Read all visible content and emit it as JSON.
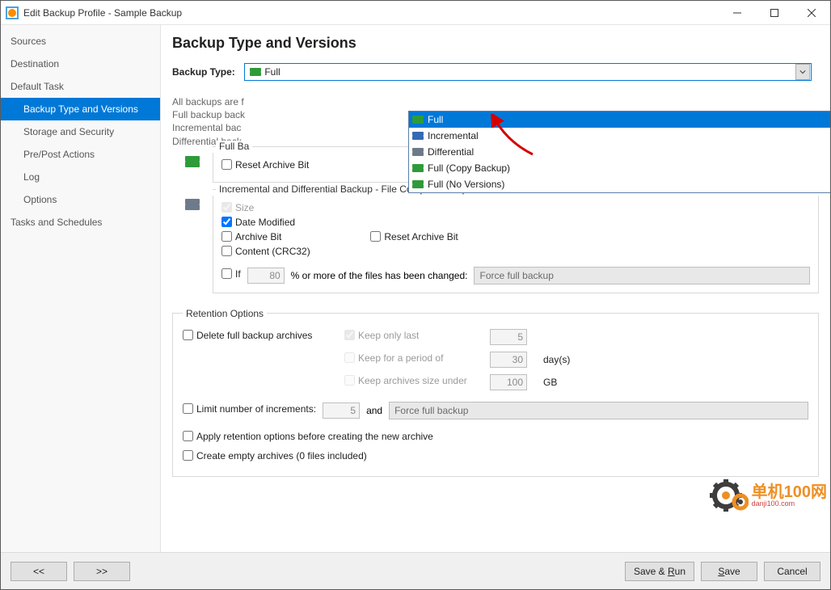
{
  "window": {
    "title": "Edit Backup Profile - Sample Backup"
  },
  "sidebar": {
    "items": [
      {
        "label": "Sources"
      },
      {
        "label": "Destination"
      },
      {
        "label": "Default Task"
      },
      {
        "label": "Backup Type and Versions"
      },
      {
        "label": "Storage and Security"
      },
      {
        "label": "Pre/Post Actions"
      },
      {
        "label": "Log"
      },
      {
        "label": "Options"
      },
      {
        "label": "Tasks and Schedules"
      }
    ]
  },
  "page": {
    "title": "Backup Type and Versions",
    "backup_type_label": "Backup Type:",
    "backup_type_value": "Full",
    "info": {
      "line1": "All backups are f",
      "line2": "Full backup back",
      "line3": "Incremental bac",
      "line4": "Differential back"
    },
    "dropdown": {
      "opt1": "Full",
      "opt2": "Incremental",
      "opt3": "Differential",
      "opt4": "Full (Copy Backup)",
      "opt5": "Full (No Versions)"
    },
    "fullbox": {
      "title": "Full Ba",
      "reset": "Reset Archive Bit"
    },
    "incbox": {
      "title": "Incremental and Differential Backup - File Comparison Options",
      "size": "Size",
      "date": "Date Modified",
      "archive": "Archive Bit",
      "reset": "Reset Archive Bit",
      "content": "Content (CRC32)",
      "if": "If",
      "if_val": "80",
      "if_text": "% or more of the files has been changed:",
      "force": "Force full backup"
    },
    "retention": {
      "legend": "Retention Options",
      "delete": "Delete full backup archives",
      "keep_last": "Keep only last",
      "keep_last_val": "5",
      "keep_period": "Keep for a period of",
      "keep_period_val": "30",
      "keep_period_unit": "day(s)",
      "keep_size": "Keep archives size under",
      "keep_size_val": "100",
      "keep_size_unit": "GB",
      "limit": "Limit number of increments:",
      "limit_val": "5",
      "and": "and",
      "force": "Force full backup",
      "apply_before": "Apply retention options before creating the new archive",
      "empty": "Create empty archives (0 files included)"
    }
  },
  "footer": {
    "prev": "<<",
    "next": ">>",
    "save_run": "Save & Run",
    "save": "Save",
    "cancel": "Cancel"
  },
  "watermark": {
    "line1": "单机100网",
    "line2": "danji100.com"
  }
}
